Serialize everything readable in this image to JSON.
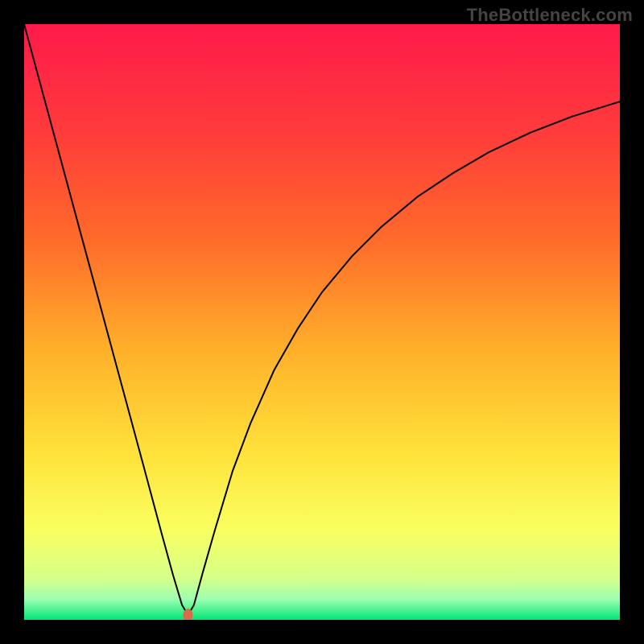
{
  "watermark": "TheBottleneck.com",
  "chart_data": {
    "type": "line",
    "title": "",
    "xlabel": "",
    "ylabel": "",
    "xlim": [
      0,
      100
    ],
    "ylim": [
      0,
      100
    ],
    "legend": false,
    "grid": false,
    "background_gradient": {
      "direction": "vertical",
      "stops": [
        {
          "offset": 0.0,
          "color": "#ff1a4b"
        },
        {
          "offset": 0.18,
          "color": "#ff3b3b"
        },
        {
          "offset": 0.36,
          "color": "#ff6a2a"
        },
        {
          "offset": 0.55,
          "color": "#ffb12a"
        },
        {
          "offset": 0.72,
          "color": "#ffe23a"
        },
        {
          "offset": 0.85,
          "color": "#f9ff60"
        },
        {
          "offset": 0.93,
          "color": "#d6ff8a"
        },
        {
          "offset": 0.965,
          "color": "#9dffb0"
        },
        {
          "offset": 1.0,
          "color": "#00e676"
        }
      ]
    },
    "series": [
      {
        "name": "bottleneck-curve",
        "stroke": "#000000",
        "stroke_width": 2,
        "x": [
          0,
          4,
          8,
          12,
          16,
          20,
          23,
          25,
          26.5,
          27.5,
          28.5,
          30,
          32,
          35,
          38,
          42,
          46,
          50,
          55,
          60,
          66,
          72,
          78,
          85,
          92,
          100
        ],
        "y": [
          100,
          85.2,
          70.4,
          55.6,
          40.8,
          26,
          14.8,
          7.5,
          2.5,
          0.8,
          2.5,
          8,
          15,
          25,
          33,
          42,
          49,
          55,
          61,
          66,
          71,
          75,
          78.5,
          81.8,
          84.5,
          87
        ]
      }
    ],
    "markers": [
      {
        "name": "optimal-point",
        "x": 27.5,
        "y": 0.8,
        "color": "#d96d4a",
        "rx": 6,
        "ry": 8
      }
    ]
  }
}
